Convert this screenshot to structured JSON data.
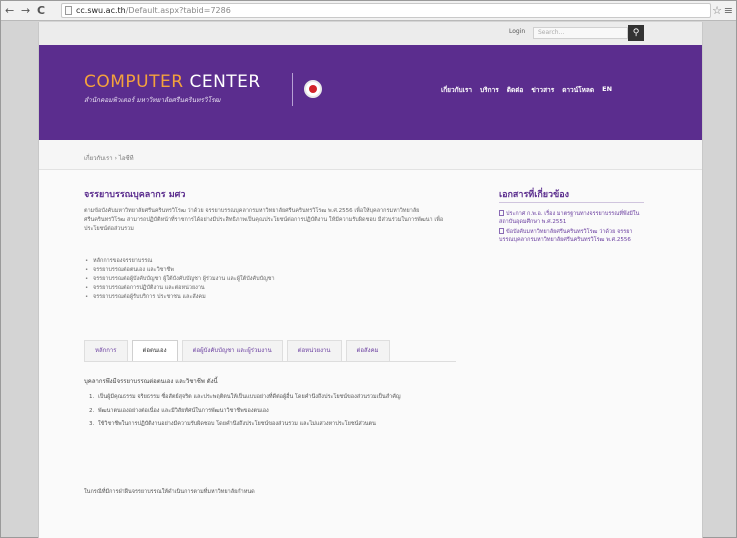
{
  "browser": {
    "back": "←",
    "forward": "→",
    "reload": "C",
    "url_domain": "cc.swu.ac.th",
    "url_path": "/Default.aspx?tabid=7286",
    "star": "☆",
    "menu": "≡"
  },
  "topbar": {
    "login": "Login",
    "search_placeholder": "Search...",
    "search_icon": "🔍"
  },
  "header": {
    "title_a": "COMPUTER",
    "title_b": " CENTER",
    "subtitle": "สำนักคอมพิวเตอร์ มหาวิทยาลัยศรีนครินทรวิโรฒ",
    "nav": [
      "เกี่ยวกับเรา",
      "บริการ",
      "ติดต่อ",
      "ข่าวสาร",
      "ดาวน์โหลด",
      "EN"
    ]
  },
  "breadcrumb": {
    "home": "เกี่ยวกับเรา",
    "sep": "›",
    "current": "ไอซีที"
  },
  "main": {
    "title": "จรรยาบรรณบุคลากร มศว",
    "intro": "ตามข้อบังคับมหาวิทยาลัยศรีนครินทรวิโรฒ ว่าด้วย จรรยาบรรณบุคลากรมหาวิทยาลัยศรีนครินทรวิโรฒ พ.ศ.2556 เพื่อให้บุคลากรมหาวิทยาลัยศรีนครินทรวิโรฒ สามารถปฏิบัติหน้าที่ราชการได้อย่างมีประสิทธิภาพเป็นคุณประโยชน์ต่อการปฏิบัติงาน ให้มีความรับผิดชอบ มีส่วนร่วมในการพัฒนา เพื่อประโยชน์ต่อส่วนรวม",
    "bullets": [
      "หลักการของจรรยาบรรณ",
      "จรรยาบรรณต่อตนเอง และวิชาชีพ",
      "จรรยาบรรณต่อผู้บังคับบัญชา ผู้ใต้บังคับบัญชา ผู้ร่วมงาน และผู้ใต้บังคับบัญชา",
      "จรรยาบรรณต่อการปฏิบัติงาน และต่อหน่วยงาน",
      "จรรยาบรรณต่อผู้รับบริการ ประชาชน และสังคม"
    ],
    "tabs": [
      "หลักการ",
      "ต่อตนเอง",
      "ต่อผู้บังคับบัญชา และผู้ร่วมงาน",
      "ต่อหน่วยงาน",
      "ต่อสังคม"
    ],
    "section_head": "บุคลากรพึงมีจรรยาบรรณต่อตนเอง และวิชาชีพ ดังนี้",
    "items": [
      "เป็นผู้มีคุณธรรม จริยธรรม ซื่อสัตย์สุจริต และประพฤติตนให้เป็นแบบอย่างที่ดีต่อผู้อื่น โดยคำนึงถึงประโยชน์ของส่วนรวมเป็นสำคัญ",
      "พัฒนาตนเองอย่างต่อเนื่อง และมีวิสัยทัศน์ในการพัฒนาวิชาชีพของตนเอง",
      "ใช้วิชาชีพในการปฏิบัติงานอย่างมีความรับผิดชอบ โดยคำนึงถึงประโยชน์ของส่วนรวม และไม่แสวงหาประโยชน์ส่วนตน"
    ],
    "footnote": "ในกรณีที่มีการฝ่าฝืนจรรยาบรรณให้ดำเนินการตามที่มหาวิทยาลัยกำหนด"
  },
  "side": {
    "title": "เอกสารที่เกี่ยวข้อง",
    "docs": [
      "ประกาศ ก.พ.อ. เรื่อง มาตรฐานทางจรรยาบรรณที่พึงมีในสถาบันอุดมศึกษา พ.ศ.2551",
      "ข้อบังคับมหาวิทยาลัยศรีนครินทรวิโรฒ ว่าด้วย จรรยาบรรณบุคลากรมหาวิทยาลัยศรีนครินทรวิโรฒ พ.ศ.2556"
    ]
  }
}
